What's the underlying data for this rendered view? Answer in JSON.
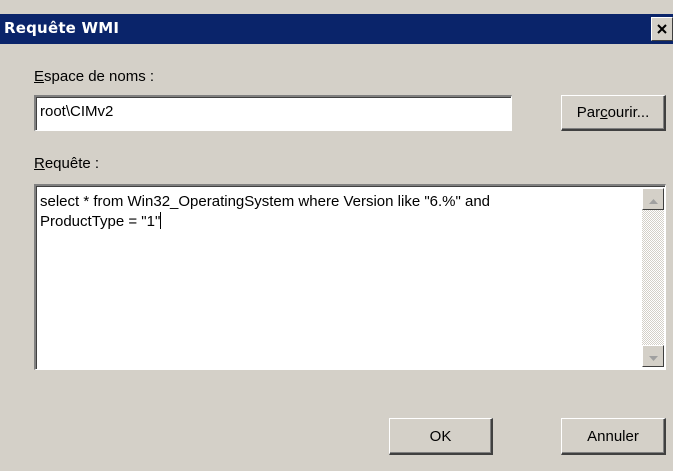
{
  "window": {
    "title": "Requête WMI",
    "close_icon": "close-icon"
  },
  "namespace": {
    "label_accel": "E",
    "label_rest": "space de noms :",
    "value": "root\\CIMv2"
  },
  "browse_button": {
    "label_pre": "Par",
    "label_accel": "c",
    "label_post": "ourir..."
  },
  "query": {
    "label_accel": "R",
    "label_rest": "equête :",
    "value": "select * from Win32_OperatingSystem where Version like \"6.%\" and\nProductType = \"1\""
  },
  "buttons": {
    "ok": "OK",
    "cancel": "Annuler"
  }
}
